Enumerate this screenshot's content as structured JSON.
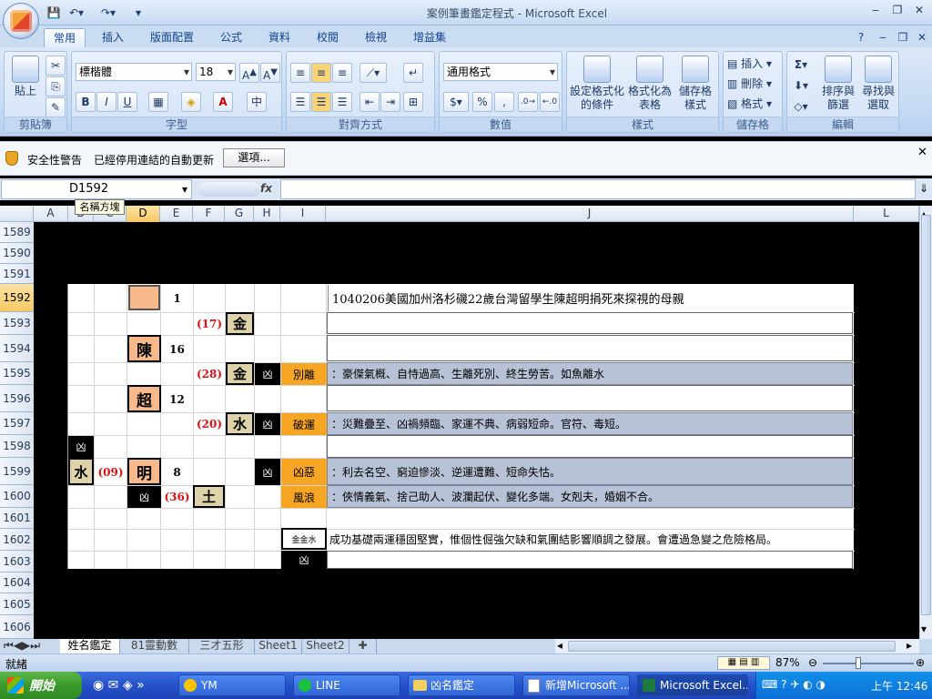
{
  "window": {
    "title": "案例筆畫鑑定程式 - Microsoft Excel"
  },
  "tabs": [
    "常用",
    "插入",
    "版面配置",
    "公式",
    "資料",
    "校閱",
    "檢視",
    "增益集"
  ],
  "ribbon": {
    "paste_label": "貼上",
    "clipboard_label": "剪貼簿",
    "font_name": "標楷體",
    "font_size": "18",
    "font_label": "字型",
    "align_label": "對齊方式",
    "number_format": "通用格式",
    "number_label": "數值",
    "styles": {
      "conditional": "設定格式化的條件",
      "table": "格式化為表格",
      "cell": "儲存格樣式",
      "label": "樣式"
    },
    "cells": {
      "insert": "插入",
      "delete": "刪除",
      "format": "格式",
      "label": "儲存格"
    },
    "editing": {
      "sort": "排序與篩選",
      "find": "尋找與選取",
      "label": "編輯"
    }
  },
  "security": {
    "title": "安全性警告",
    "message": "已經停用連結的自動更新",
    "options_button": "選項..."
  },
  "formula_bar": {
    "name_box": "D1592",
    "fx": "fx",
    "tooltip": "名稱方塊"
  },
  "columns": [
    "A",
    "B",
    "C",
    "D",
    "E",
    "F",
    "G",
    "H",
    "I",
    "J",
    "L"
  ],
  "rows": [
    "1589",
    "1590",
    "1591",
    "1592",
    "1593",
    "1594",
    "1595",
    "1596",
    "1597",
    "1598",
    "1599",
    "1600",
    "1601",
    "1602",
    "1603",
    "1604",
    "1605",
    "1606"
  ],
  "sheet": {
    "headline": "1040206美國加州洛杉磯22歲台灣留學生陳超明捐死來探視的母親",
    "d1592_num": "1",
    "d1593_tag": "(17)",
    "d1593_char": "金",
    "d1594_char": "陳",
    "d1594_num": "16",
    "d1595_tag": "(28)",
    "d1595_char": "金",
    "d1595_xi": "凶",
    "d1595_label": "別離",
    "d1595_desc": "：豪傑氣概、自恃過高、生離死別、終生勞苦。如魚離水",
    "d1596_char": "超",
    "d1596_num": "12",
    "d1597_tag": "(20)",
    "d1597_char": "水",
    "d1597_xi": "凶",
    "d1597_label": "破運",
    "d1597_desc": "：災難疊至、凶禍頻臨、家運不典、病弱短命。官符、毒短。",
    "d1598_xi": "凶",
    "d1599_a_char": "水",
    "d1599_tag": "(09)",
    "d1599_char": "明",
    "d1599_num": "8",
    "d1599_xi": "凶",
    "d1599_label": "凶惡",
    "d1599_desc": "：利去名空、窮迫慘淡、逆運遭難、短命失怙。",
    "d1600_xi": "凶",
    "d1600_tag": "(36)",
    "d1600_char": "土",
    "d1600_label": "風浪",
    "d1600_desc": "：俠情義氣、捨己助人、波瀾起伏、變化多端。女剋夫，婚姻不合。",
    "d1602_combo": "金金水",
    "d1602_desc": "成功基礎兩運穩固堅實，惟個性倔強欠缺和氣團結影響順調之發展。會遭過急變之危險格局。",
    "d1603_xi": "凶"
  },
  "sheet_tabs": [
    "姓名鑑定",
    "81靈動數",
    "三才五形",
    "Sheet1",
    "Sheet2"
  ],
  "status": {
    "mode": "就緒",
    "zoom": "87%"
  },
  "taskbar": {
    "start": "開始",
    "items": [
      "YM",
      "LINE",
      "凶名鑑定",
      "新增Microsoft ...",
      "Microsoft Excel..."
    ],
    "clock": "上午 12:46"
  }
}
